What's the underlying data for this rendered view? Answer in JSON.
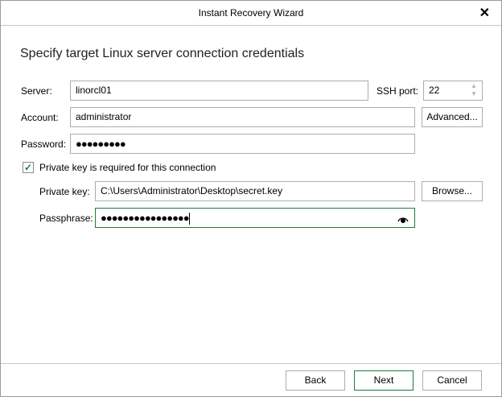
{
  "window": {
    "title": "Instant Recovery Wizard",
    "close_icon": "close-icon"
  },
  "heading": "Specify target Linux server connection credentials",
  "form": {
    "server_label": "Server:",
    "server_value": "linorcl01",
    "ssh_port_label": "SSH port:",
    "ssh_port_value": "22",
    "account_label": "Account:",
    "account_value": "administrator",
    "advanced_label": "Advanced...",
    "password_label": "Password:",
    "password_value": "●●●●●●●●●",
    "private_key_checkbox_label": "Private key is required for this connection",
    "private_key_checked": true,
    "private_key_label": "Private key:",
    "private_key_value": "C:\\Users\\Administrator\\Desktop\\secret.key",
    "browse_label": "Browse...",
    "passphrase_label": "Passphrase:",
    "passphrase_value": "●●●●●●●●●●●●●●●●"
  },
  "footer": {
    "back": "Back",
    "next": "Next",
    "cancel": "Cancel"
  },
  "colors": {
    "accent": "#1e7a3c"
  }
}
